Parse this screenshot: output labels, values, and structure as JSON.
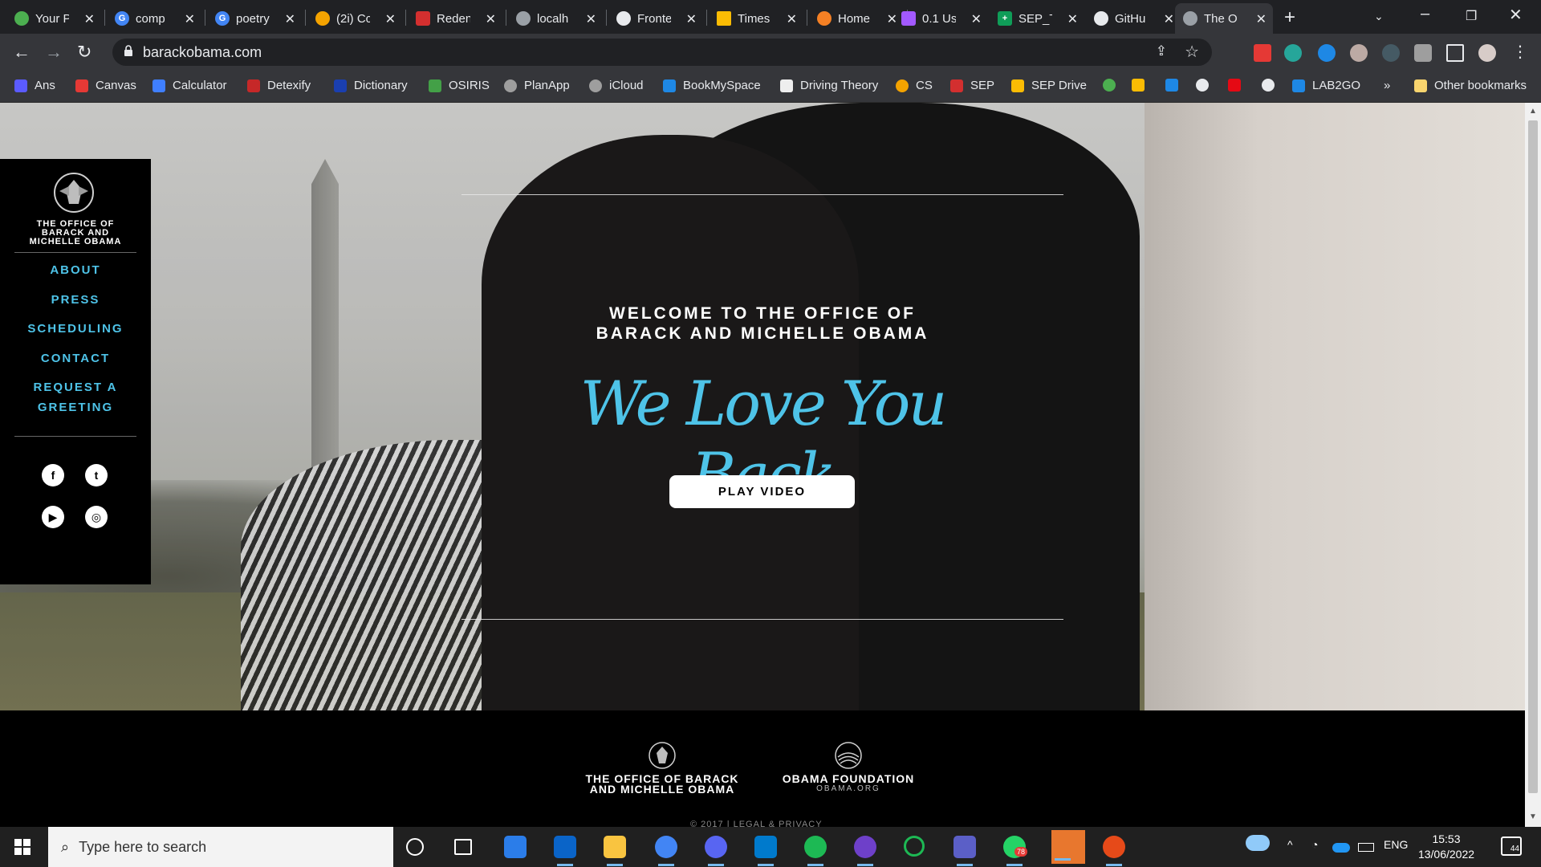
{
  "browser": {
    "tabs": [
      {
        "label": "Your P",
        "color": "#4caf50"
      },
      {
        "label": "comp",
        "color": "#4285f4"
      },
      {
        "label": "poetry",
        "color": "#4285f4"
      },
      {
        "label": "(2i) Cc",
        "color": "#f4a300"
      },
      {
        "label": "Reden",
        "color": "#d32f2f"
      },
      {
        "label": "localh",
        "color": "#9aa0a6"
      },
      {
        "label": "Fronte",
        "color": "#e8eaed"
      },
      {
        "label": "Times",
        "color": "#fbbc04"
      },
      {
        "label": "Home",
        "color": "#f48024"
      },
      {
        "label": "0.1 Us",
        "color": "#a259ff"
      },
      {
        "label": "SEP_T",
        "color": "#0f9d58"
      },
      {
        "label": "GitHu",
        "color": "#e8eaed"
      },
      {
        "label": "The O",
        "color": "#9aa0a6"
      }
    ],
    "url": "barackobama.com",
    "bookmarks": [
      {
        "label": "Ans",
        "color": "#5b5bff"
      },
      {
        "label": "Canvas",
        "color": "#e53935"
      },
      {
        "label": "Calculator",
        "color": "#3f7fff"
      },
      {
        "label": "Detexify",
        "color": "#c62828"
      },
      {
        "label": "Dictionary",
        "color": "#1a3fb0"
      },
      {
        "label": "OSIRIS",
        "color": "#43a047"
      },
      {
        "label": "PlanApp",
        "color": "#9e9e9e"
      },
      {
        "label": "iCloud",
        "color": "#9e9e9e"
      },
      {
        "label": "BookMySpace",
        "color": "#1e88e5"
      },
      {
        "label": "Driving Theory",
        "color": "#eeeeee"
      },
      {
        "label": "CS",
        "color": "#f4a300"
      },
      {
        "label": "SEP",
        "color": "#d32f2f"
      },
      {
        "label": "SEP Drive",
        "color": "#fbbc04"
      }
    ],
    "bookmark_overflow": "»",
    "other_bookmarks": "Other bookmarks"
  },
  "sidebar": {
    "org_name": "THE OFFICE OF BARACK AND MICHELLE OBAMA",
    "nav": [
      "ABOUT",
      "PRESS",
      "SCHEDULING",
      "CONTACT",
      "REQUEST A",
      "GREETING"
    ],
    "social": [
      "f",
      "t",
      "▶",
      "◎"
    ]
  },
  "hero": {
    "welcome_line1": "WELCOME TO THE OFFICE OF",
    "welcome_line2": "BARACK AND MICHELLE OBAMA",
    "tagline": "We Love You Back",
    "play_button": "PLAY VIDEO"
  },
  "footer": {
    "office_line1": "THE OFFICE OF BARACK",
    "office_line2": "AND MICHELLE OBAMA",
    "foundation_name": "OBAMA FOUNDATION",
    "foundation_url": "OBAMA.ORG",
    "copyright": "© 2017 | LEGAL & PRIVACY"
  },
  "taskbar": {
    "search_placeholder": "Type here to search",
    "language": "ENG",
    "time": "15:53",
    "date": "13/06/2022",
    "notification_count": "44",
    "whatsapp_badge": "78"
  },
  "colors": {
    "accent_blue": "#4ec3e8",
    "chrome_dark": "#202124",
    "chrome_mid": "#35363a"
  }
}
